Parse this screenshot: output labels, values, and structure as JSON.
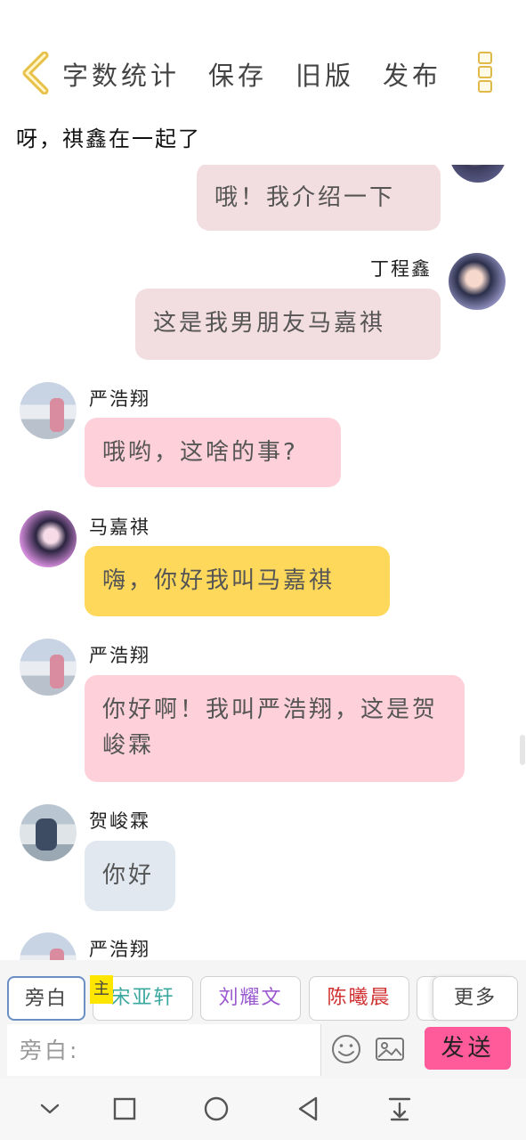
{
  "header": {
    "nav": [
      "字数统计",
      "保存",
      "旧版",
      "发布"
    ],
    "title": "呀，祺鑫在一起了"
  },
  "messages": [
    {
      "side": "right",
      "name": "",
      "text": "哦！我介绍一下"
    },
    {
      "side": "right",
      "name": "丁程鑫",
      "text": "这是我男朋友马嘉祺"
    },
    {
      "side": "left",
      "name": "严浩翔",
      "text": "哦哟，这啥的事?"
    },
    {
      "side": "left",
      "name": "马嘉祺",
      "text": "嗨，你好我叫马嘉祺"
    },
    {
      "side": "left",
      "name": "严浩翔",
      "text": "你好啊！我叫严浩翔，这是贺峻霖"
    },
    {
      "side": "left",
      "name": "贺峻霖",
      "text": "你好"
    },
    {
      "side": "left",
      "name": "严浩翔",
      "text": ""
    }
  ],
  "characters": {
    "items": [
      {
        "label": "旁白",
        "color": "#444444"
      },
      {
        "label": "宋亚轩",
        "color": "#3aa8a0"
      },
      {
        "label": "刘耀文",
        "color": "#9b59d0"
      },
      {
        "label": "陈曦晨",
        "color": "#d03030"
      }
    ],
    "main_tag": "主",
    "more": "更多"
  },
  "composer": {
    "placeholder": "旁白:",
    "send_label": "发送"
  },
  "colors": {
    "pink_bubble": "#fdd0da",
    "self_bubble": "#f2dde0",
    "yellow_bubble": "#fdd85a",
    "blue_bubble": "#e1e8ef",
    "send": "#ff5a9a",
    "accent": "#e0b94a"
  }
}
